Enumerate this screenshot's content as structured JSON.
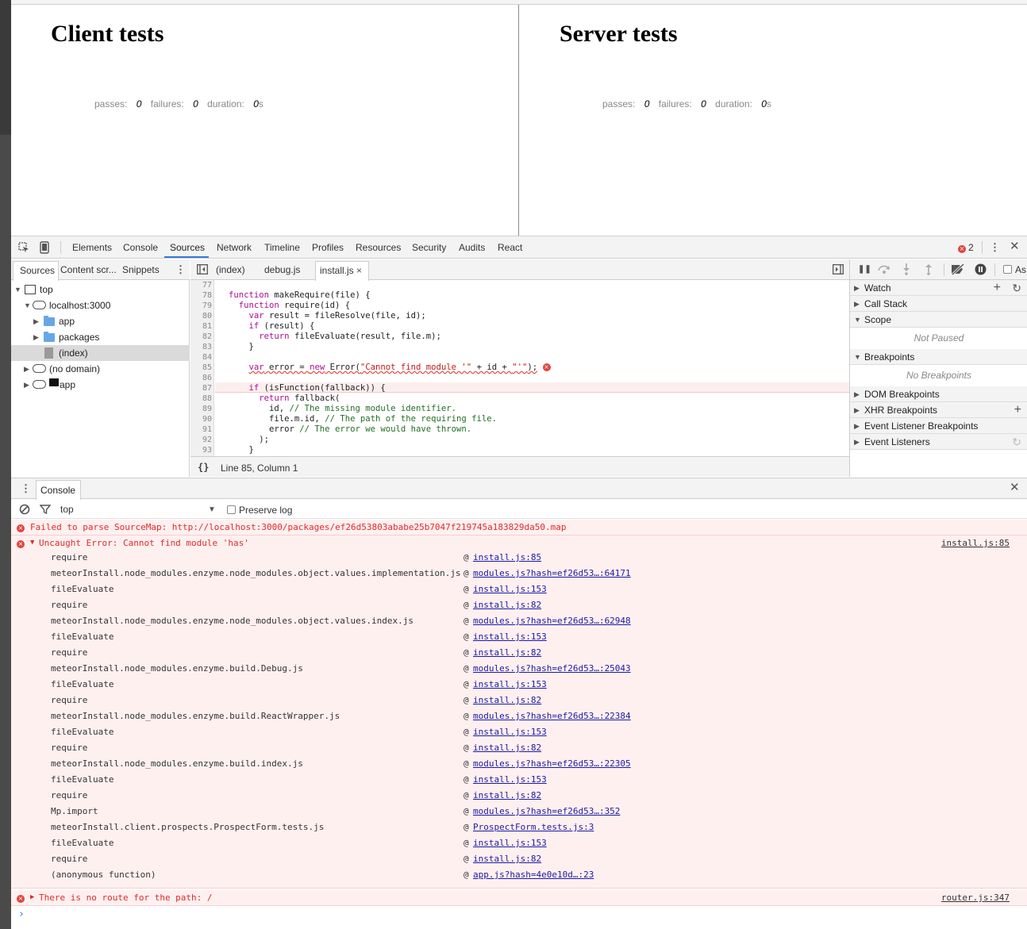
{
  "page": {
    "client_title": "Client tests",
    "server_title": "Server tests",
    "stats": {
      "passes_label": "passes:",
      "passes_value": "0",
      "failures_label": "failures:",
      "failures_value": "0",
      "duration_label": "duration:",
      "duration_value": "0",
      "duration_unit": "s"
    }
  },
  "devtools": {
    "tabs": [
      "Elements",
      "Console",
      "Sources",
      "Network",
      "Timeline",
      "Profiles",
      "Resources",
      "Security",
      "Audits",
      "React"
    ],
    "active_tab": "Sources",
    "error_count": "2",
    "navigator": {
      "tabs": [
        "Sources",
        "Content scr...",
        "Snippets"
      ],
      "tree": {
        "top": "top",
        "host": "localhost:3000",
        "app": "app",
        "packages": "packages",
        "index": "(index)",
        "no_domain": "(no domain)",
        "app2": "app"
      }
    },
    "editor": {
      "tabs": [
        "(index)",
        "debug.js",
        "install.js"
      ],
      "active_tab": "install.js",
      "close_glyph": "×",
      "line_numbers": [
        "77",
        "78",
        "79",
        "80",
        "81",
        "82",
        "83",
        "84",
        "85",
        "86",
        "87",
        "88",
        "89",
        "90",
        "91",
        "92",
        "93"
      ],
      "status": "Line 85, Column 1",
      "braces": "{}"
    },
    "sidebar": {
      "as_label": "As",
      "sections": [
        "Watch",
        "Call Stack",
        "Scope",
        "Breakpoints",
        "DOM Breakpoints",
        "XHR Breakpoints",
        "Event Listener Breakpoints",
        "Event Listeners"
      ],
      "scope_body": "Not Paused",
      "breakpoints_body": "No Breakpoints"
    },
    "console": {
      "tab": "Console",
      "context": "top",
      "preserve_log": "Preserve log",
      "messages": {
        "m1": "Failed to parse SourceMap: http://localhost:3000/packages/ef26d53803ababe25b7047f219745a183829da50.map",
        "m2": "Uncaught Error: Cannot find module 'has'",
        "m2_src": "install.js:85",
        "m3": "There is no route for the path: /",
        "m3_src": "router.js:347"
      },
      "stack": [
        {
          "fn": "require",
          "loc": "install.js:85"
        },
        {
          "fn": "meteorInstall.node_modules.enzyme.node_modules.object.values.implementation.js",
          "loc": "modules.js?hash=ef26d53…:64171"
        },
        {
          "fn": "fileEvaluate",
          "loc": "install.js:153"
        },
        {
          "fn": "require",
          "loc": "install.js:82"
        },
        {
          "fn": "meteorInstall.node_modules.enzyme.node_modules.object.values.index.js",
          "loc": "modules.js?hash=ef26d53…:62948"
        },
        {
          "fn": "fileEvaluate",
          "loc": "install.js:153"
        },
        {
          "fn": "require",
          "loc": "install.js:82"
        },
        {
          "fn": "meteorInstall.node_modules.enzyme.build.Debug.js",
          "loc": "modules.js?hash=ef26d53…:25043"
        },
        {
          "fn": "fileEvaluate",
          "loc": "install.js:153"
        },
        {
          "fn": "require",
          "loc": "install.js:82"
        },
        {
          "fn": "meteorInstall.node_modules.enzyme.build.ReactWrapper.js",
          "loc": "modules.js?hash=ef26d53…:22384"
        },
        {
          "fn": "fileEvaluate",
          "loc": "install.js:153"
        },
        {
          "fn": "require",
          "loc": "install.js:82"
        },
        {
          "fn": "meteorInstall.node_modules.enzyme.build.index.js",
          "loc": "modules.js?hash=ef26d53…:22305"
        },
        {
          "fn": "fileEvaluate",
          "loc": "install.js:153"
        },
        {
          "fn": "require",
          "loc": "install.js:82"
        },
        {
          "fn": "Mp.import",
          "loc": "modules.js?hash=ef26d53…:352"
        },
        {
          "fn": "meteorInstall.client.prospects.ProspectForm.tests.js",
          "loc": "ProspectForm.tests.js:3"
        },
        {
          "fn": "fileEvaluate",
          "loc": "install.js:153"
        },
        {
          "fn": "require",
          "loc": "install.js:82"
        },
        {
          "fn": "(anonymous function)",
          "loc": "app.js?hash=4e0e10d…:23"
        }
      ],
      "at_glyph": "@",
      "prompt": "›"
    }
  }
}
